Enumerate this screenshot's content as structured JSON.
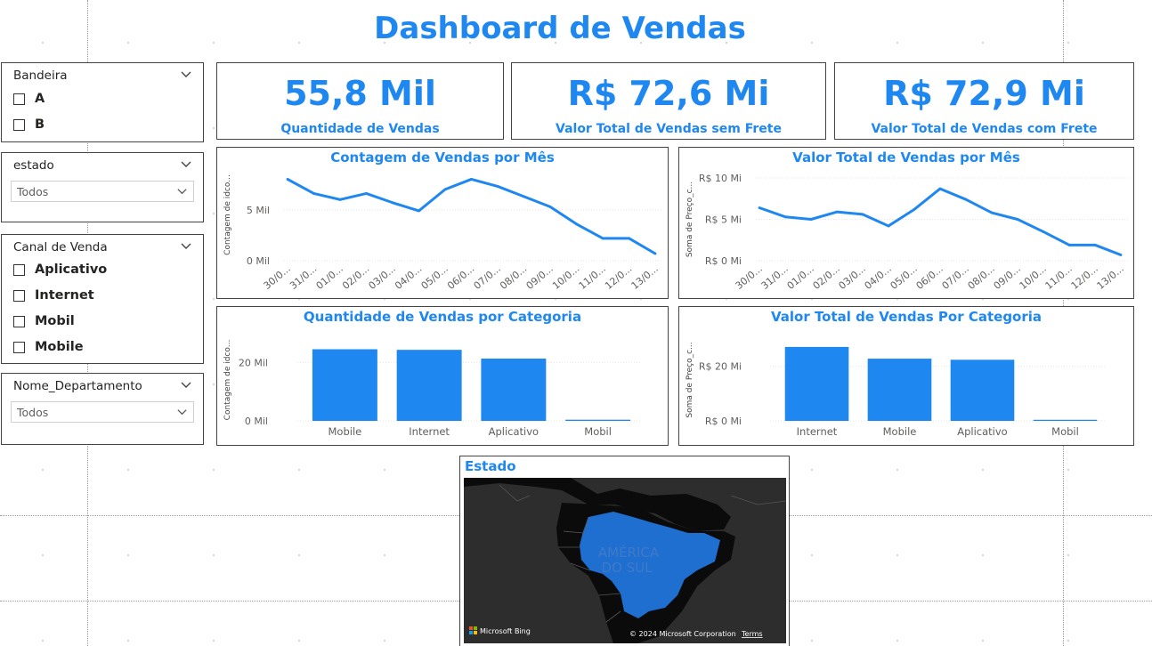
{
  "header": {
    "title": "Dashboard de Vendas"
  },
  "slicers": {
    "bandeira": {
      "title": "Bandeira",
      "options": [
        "A",
        "B"
      ]
    },
    "estado": {
      "title": "estado",
      "value": "Todos"
    },
    "canal": {
      "title": "Canal de Venda",
      "options": [
        "Aplicativo",
        "Internet",
        "Mobil",
        "Mobile"
      ]
    },
    "departamento": {
      "title": "Nome_Departamento",
      "value": "Todos"
    }
  },
  "kpis": [
    {
      "value": "55,8 Mil",
      "label": "Quantidade de Vendas"
    },
    {
      "value": "R$ 72,6 Mi",
      "label": "Valor Total de Vendas sem Frete"
    },
    {
      "value": "R$ 72,9 Mi",
      "label": "Valor Total de Vendas com Frete"
    }
  ],
  "chart_data": [
    {
      "type": "line",
      "title": "Contagem de Vendas por Mês",
      "ylabel": "Contagem de idco...",
      "xlabel": "",
      "categories": [
        "30/0...",
        "31/0...",
        "01/0...",
        "02/0...",
        "03/0...",
        "04/0...",
        "05/0...",
        "06/0...",
        "07/0...",
        "08/0...",
        "09/0...",
        "10/0...",
        "11/0...",
        "12/0...",
        "13/0..."
      ],
      "x_positions": [
        0,
        1,
        2,
        3,
        4,
        5,
        6,
        7,
        8,
        9,
        10,
        11,
        12,
        13,
        14
      ],
      "values": [
        8000,
        6600,
        6000,
        6600,
        5700,
        4900,
        7000,
        8000,
        7300,
        6300,
        5300,
        3600,
        2200,
        2200,
        700
      ],
      "y_ticks": [
        {
          "value": 0,
          "label": "0 Mil"
        },
        {
          "value": 5000,
          "label": "5 Mil"
        }
      ],
      "ylim": [
        0,
        9000
      ],
      "color": "#1f87f0"
    },
    {
      "type": "line",
      "title": "Valor Total de Vendas por Mês",
      "ylabel": "Soma de Preço_c...",
      "xlabel": "",
      "categories": [
        "30/0...",
        "31/0...",
        "01/0...",
        "02/0...",
        "03/0...",
        "04/0...",
        "05/0...",
        "06/0...",
        "07/0...",
        "08/0...",
        "09/0...",
        "10/0...",
        "11/0...",
        "12/0...",
        "13/0..."
      ],
      "x_positions": [
        0,
        1,
        2,
        3,
        4,
        5,
        6,
        7,
        8,
        9,
        10,
        11,
        12,
        13,
        14
      ],
      "values": [
        6400000,
        5300000,
        5000000,
        5900000,
        5600000,
        4200000,
        6200000,
        8700000,
        7400000,
        5800000,
        5000000,
        3500000,
        1900000,
        1900000,
        700000
      ],
      "y_ticks": [
        {
          "value": 0,
          "label": "R$ 0 Mi"
        },
        {
          "value": 5000000,
          "label": "R$ 5 Mi"
        },
        {
          "value": 10000000,
          "label": "R$ 10 Mi"
        }
      ],
      "ylim": [
        0,
        10000000
      ],
      "color": "#1f87f0"
    },
    {
      "type": "bar",
      "title": "Quantidade de Vendas por Categoria",
      "ylabel": "Contagem de idco...",
      "xlabel": "",
      "categories": [
        "Mobile",
        "Internet",
        "Aplicativo",
        "Mobil"
      ],
      "values": [
        24500,
        24300,
        21300,
        400
      ],
      "y_ticks": [
        {
          "value": 0,
          "label": "0 Mil"
        },
        {
          "value": 20000,
          "label": "20 Mil"
        }
      ],
      "ylim": [
        0,
        28000
      ],
      "color": "#1f87f0"
    },
    {
      "type": "bar",
      "title": "Valor Total de Vendas Por Categoria",
      "ylabel": "Soma de Preço_c...",
      "xlabel": "",
      "categories": [
        "Internet",
        "Mobile",
        "Aplicativo",
        "Mobil"
      ],
      "values": [
        27100000,
        22800000,
        22400000,
        400000
      ],
      "y_ticks": [
        {
          "value": 0,
          "label": "R$ 0 Mi"
        },
        {
          "value": 20000000,
          "label": "R$ 20 Mi"
        }
      ],
      "ylim": [
        0,
        30000000
      ],
      "color": "#1f87f0"
    }
  ],
  "map": {
    "title": "Estado",
    "region_label_line1": "AMÉRICA",
    "region_label_line2": "DO SUL",
    "provider": "Microsoft Bing",
    "copyright": "© 2024 Microsoft Corporation",
    "terms": "Terms",
    "background_color": "#2d2d2d",
    "land_color": "#0b0b0b",
    "highlight_color": "#1f6fd1"
  },
  "colors": {
    "accent": "#1f87f0"
  }
}
